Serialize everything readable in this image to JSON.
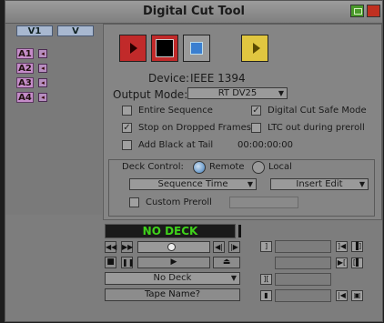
{
  "window": {
    "title": "Digital Cut Tool"
  },
  "tracks": {
    "video": [
      "V1",
      "V"
    ],
    "audio": [
      "A1",
      "A2",
      "A3",
      "A4"
    ]
  },
  "device": {
    "label": "Device:",
    "value": "IEEE 1394"
  },
  "output_mode": {
    "label": "Output Mode:",
    "value": "RT DV25"
  },
  "options": {
    "entire_sequence": {
      "label": "Entire Sequence",
      "checked": false
    },
    "digital_cut_safe_mode": {
      "label": "Digital Cut Safe Mode",
      "checked": true
    },
    "stop_on_dropped_frames": {
      "label": "Stop on Dropped Frames",
      "checked": true
    },
    "ltc_out_during_preroll": {
      "label": "LTC out during preroll",
      "checked": false
    },
    "add_black_at_tail": {
      "label": "Add Black at Tail",
      "checked": false,
      "timecode": "00:00:00:00"
    }
  },
  "deck_control": {
    "label": "Deck Control:",
    "remote_label": "Remote",
    "local_label": "Local",
    "selected": "Remote",
    "time_mode": "Sequence Time",
    "edit_mode": "Insert Edit",
    "custom_preroll_label": "Custom Preroll",
    "custom_preroll_checked": false
  },
  "deck": {
    "status": "NO DECK",
    "deck_select": "No Deck",
    "tape_name": "Tape Name?"
  },
  "colors": {
    "status_text": "#3fd21a",
    "record_red": "#c12a2a",
    "yellow_button": "#e0c640",
    "audio_track": "#c48cc8",
    "video_track": "#a8b8d0"
  }
}
